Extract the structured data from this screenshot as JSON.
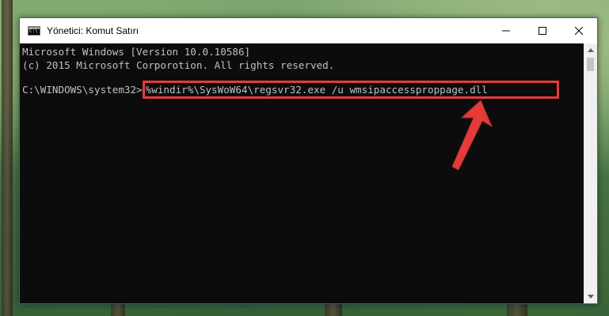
{
  "window": {
    "title": "Yönetici: Komut Satırı",
    "controls": {
      "minimize": "minimize-icon",
      "maximize": "maximize-icon",
      "close": "close-icon"
    }
  },
  "console": {
    "lines": [
      "Microsoft Windows [Version 10.0.10586]",
      "(c) 2015 Microsoft Corporotion. All rights reserved."
    ],
    "prompt": "C:\\WINDOWS\\system32>",
    "command": "%windir%\\SysWoW64\\regsvr32.exe /u wmsipaccessproppage.dll"
  },
  "annotation": {
    "highlight_color": "#e53b3b",
    "arrow_color": "#e53b3b"
  }
}
